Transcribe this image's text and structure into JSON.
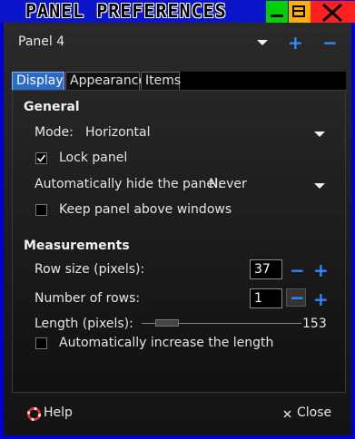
{
  "window": {
    "title": "PANEL PREFERENCES"
  },
  "panel": {
    "selected": "Panel 4"
  },
  "tabs": [
    "Display",
    "Appearance",
    "Items"
  ],
  "general": {
    "heading": "General",
    "mode_label": "Mode:",
    "mode_value": "Horizontal",
    "lock_panel_label": "Lock panel",
    "lock_panel_checked": true,
    "autohide_label": "Automatically hide the panel:",
    "autohide_value": "Never",
    "keep_above_label": "Keep panel above windows",
    "keep_above_checked": false
  },
  "measurements": {
    "heading": "Measurements",
    "row_size_label": "Row size (pixels):",
    "row_size_value": "37",
    "rows_label": "Number of rows:",
    "rows_value": "1",
    "length_label": "Length (pixels):",
    "length_value": "153",
    "length_fraction": 0.1,
    "auto_length_label": "Automatically increase the length",
    "auto_length_checked": false
  },
  "footer": {
    "help_label": "Help",
    "close_label": "Close"
  },
  "colors": {
    "accent": "#2a8cff",
    "titlebar": "#0a14c8",
    "frame": "#0000cc"
  }
}
